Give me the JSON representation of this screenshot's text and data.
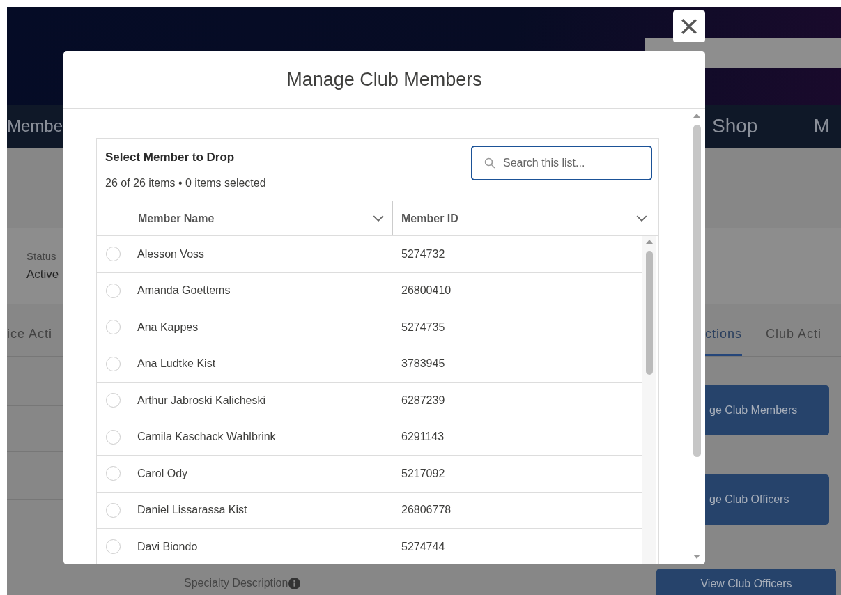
{
  "background": {
    "nav_left": "Membe",
    "nav_right": [
      "Shop",
      "M"
    ],
    "status": {
      "label": "Status",
      "value": "Active"
    },
    "tabs_left": [
      {
        "label": "ice Acti",
        "selected": false
      }
    ],
    "tabs_right": [
      {
        "label": "ctions",
        "selected": true
      },
      {
        "label": "Club Acti",
        "selected": false
      }
    ],
    "side_buttons": [
      "ge Club Members",
      "ge Club Officers"
    ],
    "field_label": "Specialty Description",
    "bottom_button": "View Club Officers"
  },
  "modal": {
    "title": "Manage Club Members",
    "list_title": "Select Member to Drop",
    "summary": "26 of 26 items • 0 items selected",
    "search": {
      "placeholder": "Search this list..."
    },
    "columns": [
      "Member Name",
      "Member ID"
    ],
    "rows": [
      {
        "name": "Alesson Voss",
        "id": "5274732",
        "selected": false
      },
      {
        "name": "Amanda Goettems",
        "id": "26800410",
        "selected": false
      },
      {
        "name": "Ana Kappes",
        "id": "5274735",
        "selected": false
      },
      {
        "name": "Ana Ludtke Kist",
        "id": "3783945",
        "selected": false
      },
      {
        "name": "Arthur Jabroski Kalicheski",
        "id": "6287239",
        "selected": false
      },
      {
        "name": "Camila Kaschack Wahlbrink",
        "id": "6291143",
        "selected": false
      },
      {
        "name": "Carol Ody",
        "id": "5217092",
        "selected": false
      },
      {
        "name": "Daniel Lissarassa Kist",
        "id": "26806778",
        "selected": false
      },
      {
        "name": "Davi Biondo",
        "id": "5274744",
        "selected": false
      }
    ]
  }
}
